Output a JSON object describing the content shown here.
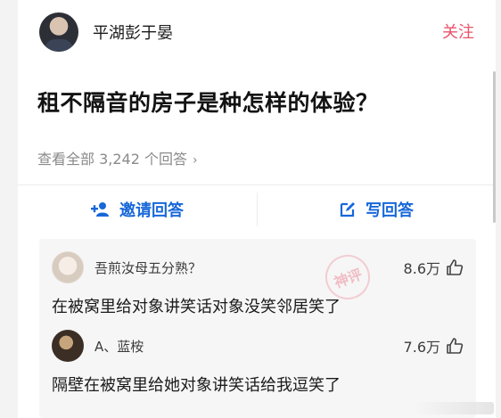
{
  "author": {
    "name": "平湖彭于晏",
    "follow_label": "关注"
  },
  "question": {
    "title": "租不隔音的房子是种怎样的体验？",
    "view_all": "查看全部 3,242 个回答",
    "view_all_chevron": "›"
  },
  "actions": {
    "invite_label": "邀请回答",
    "write_label": "写回答"
  },
  "comments": [
    {
      "user": "吾煎汝母五分熟？",
      "likes": "8.6万",
      "text": "在被窝里给对象讲笑话对象没笑邻居笑了"
    },
    {
      "user": "A、蓝桉",
      "likes": "7.6万",
      "text": "隔壁在被窝里给她对象讲笑话给我逗笑了"
    }
  ],
  "watermark": "神评",
  "colors": {
    "accent_blue": "#1767d9",
    "accent_pink": "#e9546b"
  },
  "icons": [
    "avatar",
    "add-user-icon",
    "edit-icon",
    "thumbs-up-icon",
    "chevron-right-icon"
  ]
}
